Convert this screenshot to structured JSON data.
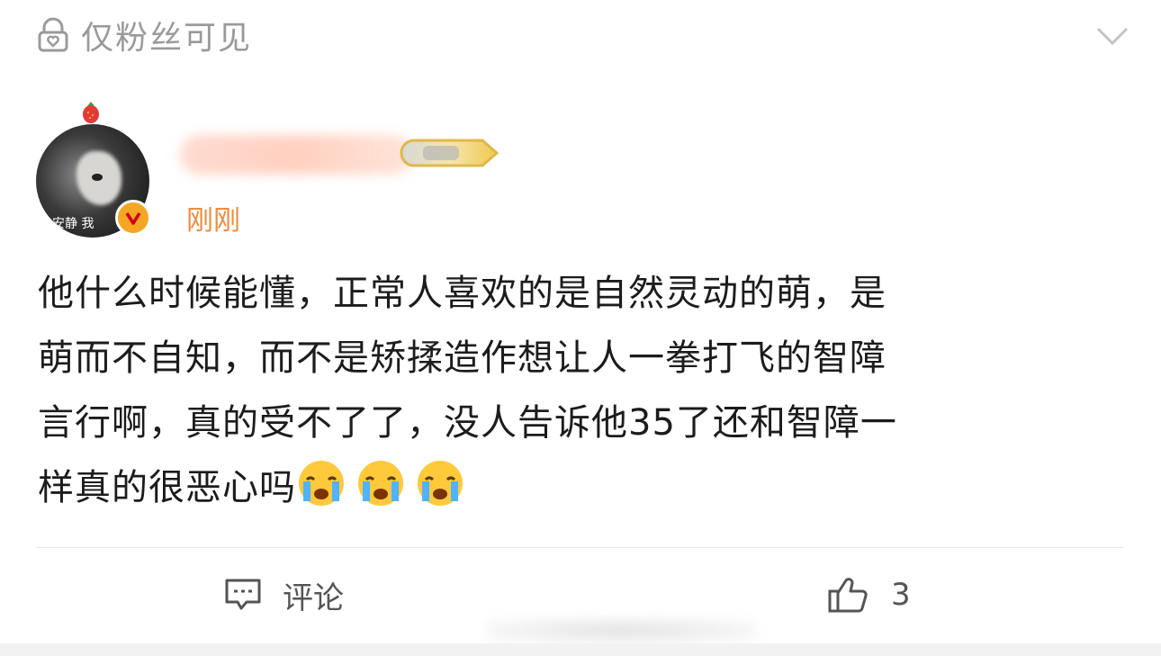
{
  "header": {
    "visibility_label": "仅粉丝可见",
    "visibility_icon": "lock-heart-icon",
    "expand_icon": "chevron-down-icon"
  },
  "author": {
    "avatar_caption": "安静 我",
    "timestamp": "刚刚",
    "verified_icon": "verified-v-icon",
    "accent_color": "#f08a3c"
  },
  "post": {
    "lines": [
      "他什么时候能懂，正常人喜欢的是自然灵动的萌，是",
      "萌而不自知，而不是矫揉造作想让人一拳打飞的智障",
      "言行啊，真的受不了了，没人告诉他35了还和智障一",
      "样真的很恶心吗"
    ],
    "emojis": [
      "crying-face-emoji",
      "crying-face-emoji",
      "crying-face-emoji"
    ]
  },
  "actions": {
    "comment_label": "评论",
    "comment_icon": "comment-icon",
    "like_count": "3",
    "like_icon": "thumbs-up-icon"
  }
}
